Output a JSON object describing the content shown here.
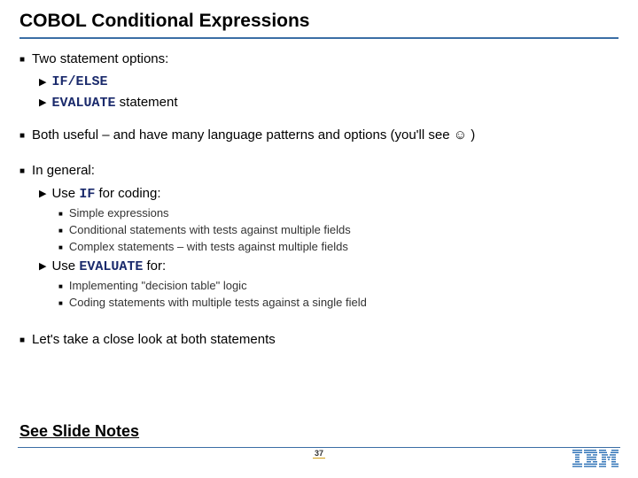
{
  "title": "COBOL Conditional Expressions",
  "bullets": {
    "l1_1": "Two statement options:",
    "l2_1_code": "IF/ELSE",
    "l2_2_code": "EVALUATE",
    "l2_2_rest": " statement",
    "l1_2a": "Both useful – and have many language patterns and options (you'll see ",
    "l1_2_smiley": "☺",
    "l1_2b": " )",
    "l1_3": "In general:",
    "l2_3_pre": "Use ",
    "l2_3_code": "IF",
    "l2_3_post": " for coding:",
    "l3_1": "Simple expressions",
    "l3_2": "Conditional statements with tests against multiple fields",
    "l3_3": "Complex statements – with tests against multiple fields",
    "l2_4_pre": "Use ",
    "l2_4_code": "EVALUATE",
    "l2_4_post": " for:",
    "l3_4": "Implementing \"decision table\" logic",
    "l3_5": "Coding statements with multiple tests against a single field",
    "l1_4": "Let's take a close look at both statements"
  },
  "footer": "See Slide Notes",
  "page": "37",
  "logo_name": "IBM"
}
